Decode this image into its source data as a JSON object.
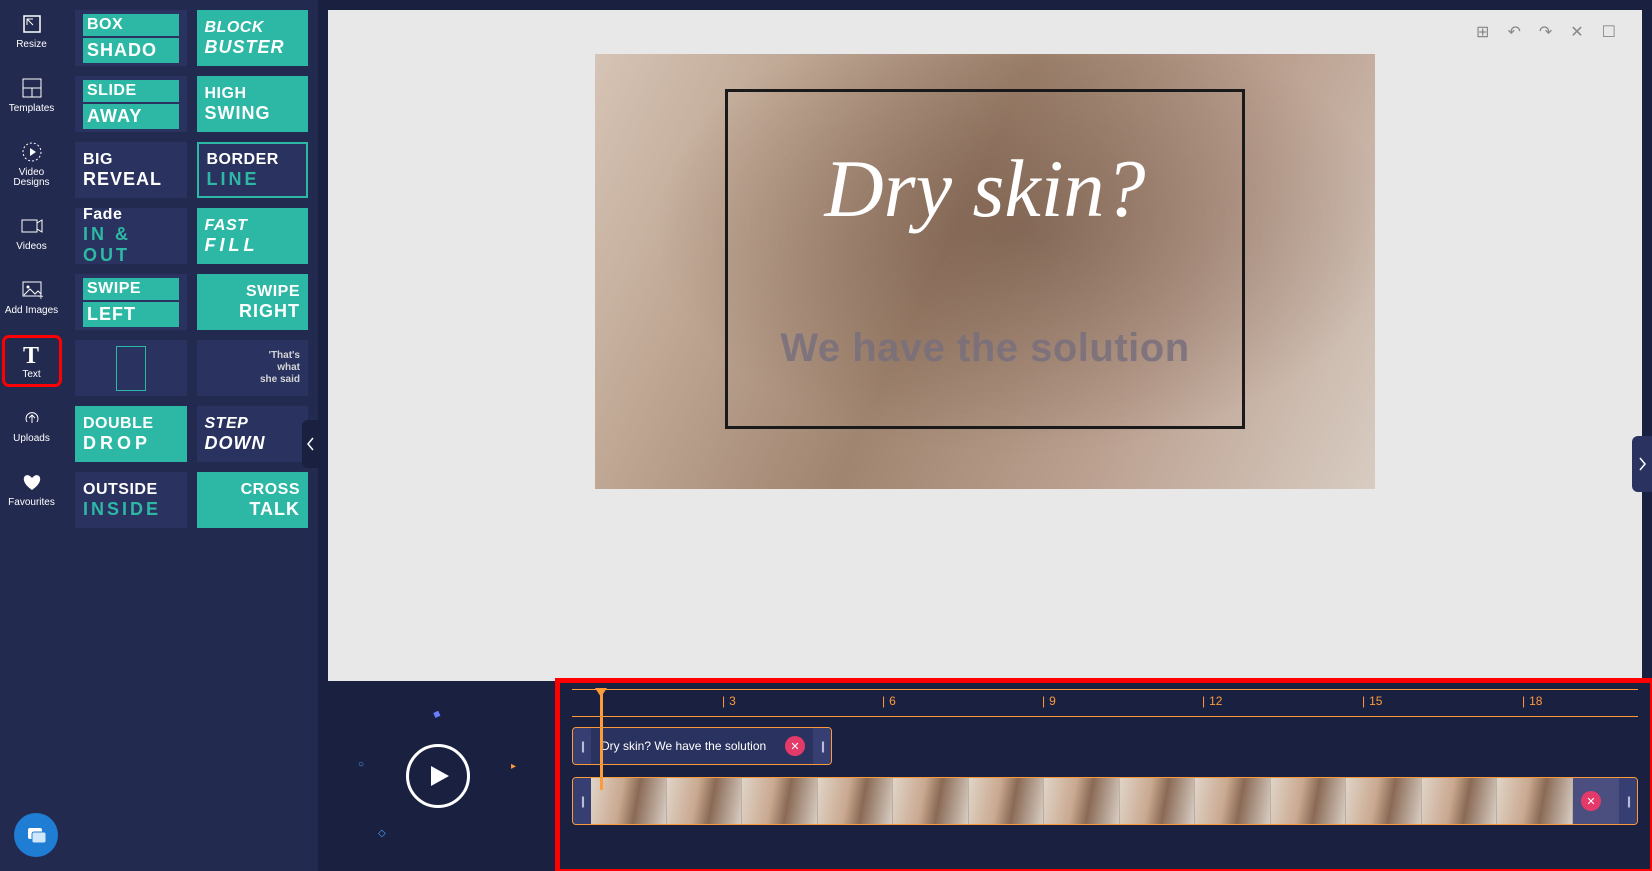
{
  "sidebar": {
    "items": [
      {
        "label": "Resize",
        "icon": "resize"
      },
      {
        "label": "Templates",
        "icon": "templates"
      },
      {
        "label": "Video Designs",
        "icon": "video-designs"
      },
      {
        "label": "Videos",
        "icon": "videos"
      },
      {
        "label": "Add Images",
        "icon": "add-images"
      },
      {
        "label": "Text",
        "icon": "text",
        "active": true
      },
      {
        "label": "Uploads",
        "icon": "uploads"
      },
      {
        "label": "Favourites",
        "icon": "favourites"
      }
    ]
  },
  "textTemplates": [
    {
      "l1": "BOX",
      "l2": "SHADO",
      "style": "teal-bar"
    },
    {
      "l1": "BLOCK",
      "l2": "BUSTER",
      "style": "teal-bg italic"
    },
    {
      "l1": "SLIDE",
      "l2": "AWAY",
      "style": "teal-bar"
    },
    {
      "l1": "HIGH",
      "l2": "SWING",
      "style": "teal-bg"
    },
    {
      "l1": "BIG",
      "l2": "REVEAL",
      "style": "plain"
    },
    {
      "l1": "BORDER",
      "l2": "LINE",
      "style": "border teal-text"
    },
    {
      "l1": "Fade",
      "l2": "IN & OUT",
      "style": "plain teal-text2"
    },
    {
      "l1": "FAST",
      "l2": "FILL",
      "style": "teal-bg italic spaced"
    },
    {
      "l1": "SWIPE",
      "l2": "LEFT",
      "style": "teal-bar"
    },
    {
      "l1": "SWIPE",
      "l2": "RIGHT",
      "style": "teal-bg right"
    },
    {
      "l1": "",
      "l2": "",
      "style": "rect"
    },
    {
      "l1": "'That's what she said",
      "l2": "",
      "style": "quote"
    },
    {
      "l1": "DOUBLE",
      "l2": "DROP",
      "style": "teal-bg spaced"
    },
    {
      "l1": "STEP",
      "l2": "DOWN",
      "style": "plain italic"
    },
    {
      "l1": "OUTSIDE",
      "l2": "INSIDE",
      "style": "plain teal-text2"
    },
    {
      "l1": "CROSS",
      "l2": "TALK",
      "style": "teal-bg right"
    }
  ],
  "canvas": {
    "title": "Dry skin?",
    "subtitle": "We have the solution"
  },
  "toolbar": {
    "grid": "⊞",
    "undo": "↶",
    "redo": "↷",
    "close": "✕",
    "full": "☐"
  },
  "timeline": {
    "ticks": [
      3,
      6,
      9,
      12,
      15,
      18
    ],
    "textClip": "Dry skin? We have the solution",
    "thumbCount": 13
  }
}
